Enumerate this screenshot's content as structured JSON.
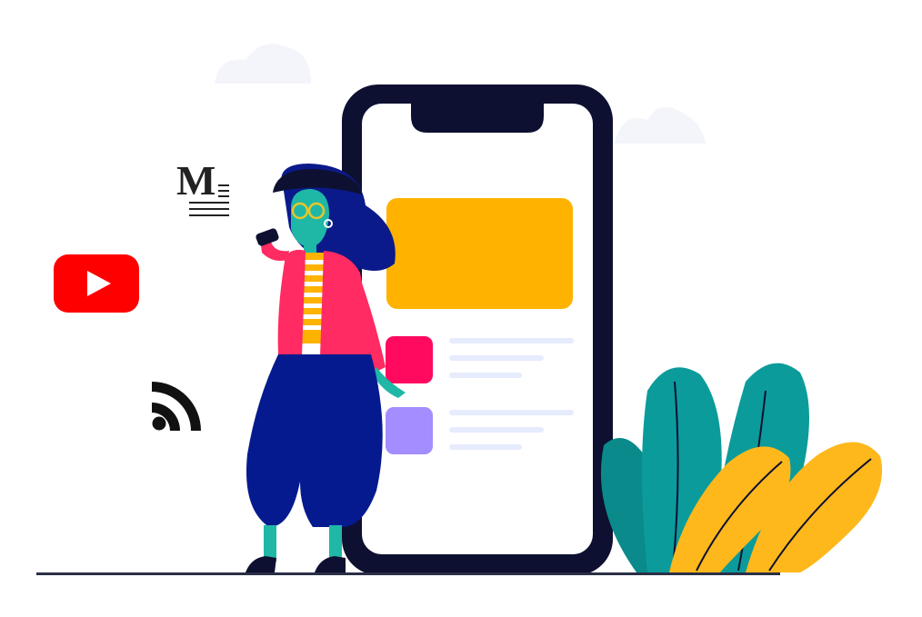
{
  "icons": {
    "medium": {
      "name": "medium-icon",
      "letter": "M",
      "color": "#222222"
    },
    "youtube": {
      "name": "youtube-icon",
      "color": "#ff0000"
    },
    "rss": {
      "name": "rss-feed-icon",
      "color": "#111111"
    }
  },
  "phone": {
    "frame_color": "#0d1030",
    "screen_color": "#ffffff",
    "banner_color": "#ffb300",
    "items": [
      {
        "name": "list-item-1",
        "thumb_color": "#ff0a5e"
      },
      {
        "name": "list-item-2",
        "thumb_color": "#a48dff"
      }
    ],
    "line_color": "#e6ebfd"
  },
  "person": {
    "jacket_color": "#ff2b62",
    "pants_color": "#061a8f",
    "skin_color": "#1fb8a6",
    "hair_color": "#0b1a8a"
  },
  "plants": {
    "teal": "#0b9b9b",
    "yellow": "#ffb81c"
  },
  "ground_color": "#2a2f45"
}
